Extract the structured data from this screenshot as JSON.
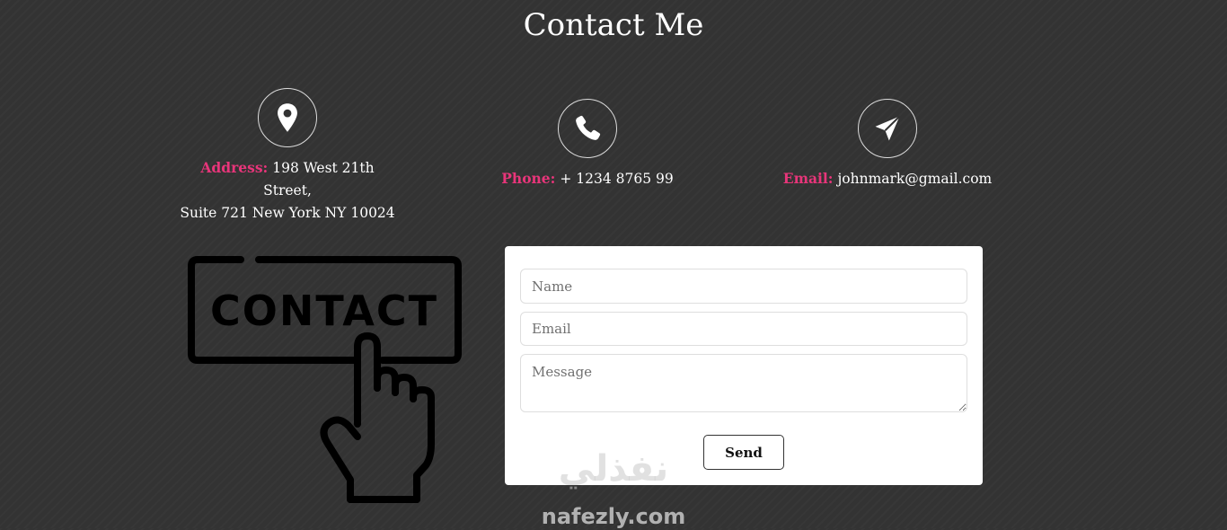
{
  "page": {
    "title": "Contact Me"
  },
  "info": {
    "address": {
      "label": "Address:",
      "value_line1": "198 West 21th Street,",
      "value_line2": "Suite 721 New York NY 10024",
      "icon": "map-pin-icon"
    },
    "phone": {
      "label": "Phone:",
      "value": "+ 1234 8765 99",
      "icon": "phone-icon"
    },
    "email": {
      "label": "Email:",
      "value": "johnmark@gmail.com",
      "icon": "paper-plane-icon"
    }
  },
  "illustration": {
    "text": "CONTACT",
    "icon": "hand-pointer-icon"
  },
  "form": {
    "name_placeholder": "Name",
    "email_placeholder": "Email",
    "message_placeholder": "Message",
    "send_label": "Send"
  },
  "watermark": {
    "arabic": "نفذلي",
    "latin": "nafezly.com"
  },
  "colors": {
    "background": "#333333",
    "accent": "#e8357a",
    "card": "#ffffff"
  }
}
